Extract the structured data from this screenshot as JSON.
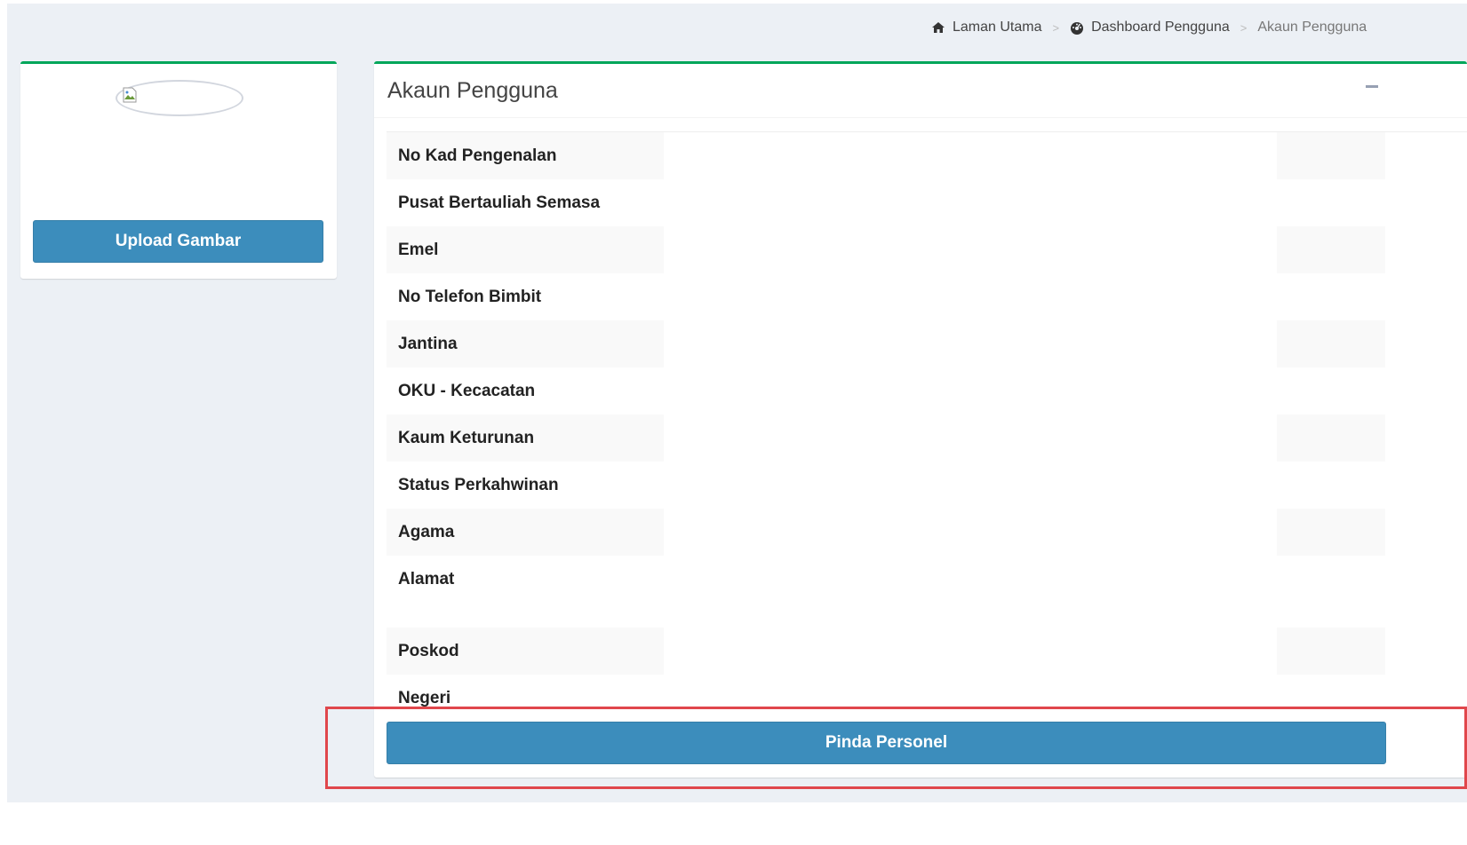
{
  "breadcrumb": {
    "home": "Laman Utama",
    "dashboard": "Dashboard Pengguna",
    "current": "Akaun Pengguna",
    "separator": ">"
  },
  "profile": {
    "avatar_icon": "broken-image-icon",
    "upload_label": "Upload Gambar"
  },
  "account": {
    "title": "Akaun Pengguna",
    "collapse_icon": "minus-icon",
    "fields": [
      {
        "label": "No Kad Pengenalan",
        "value": ""
      },
      {
        "label": "Pusat Bertauliah Semasa",
        "value": ""
      },
      {
        "label": "Emel",
        "value": ""
      },
      {
        "label": "No Telefon Bimbit",
        "value": ""
      },
      {
        "label": "Jantina",
        "value": ""
      },
      {
        "label": "OKU - Kecacatan",
        "value": ""
      },
      {
        "label": "Kaum Keturunan",
        "value": ""
      },
      {
        "label": "Status Perkahwinan",
        "value": ""
      },
      {
        "label": "Agama",
        "value": ""
      },
      {
        "label": "Alamat",
        "value": ""
      },
      {
        "label": "Poskod",
        "value": ""
      },
      {
        "label": "Negeri",
        "value": ""
      }
    ],
    "action_label": "Pinda Personel"
  },
  "colors": {
    "box_accent": "#00a65a",
    "primary_button": "#3c8dbc",
    "highlight": "#e0474c",
    "background": "#ecf0f5"
  }
}
